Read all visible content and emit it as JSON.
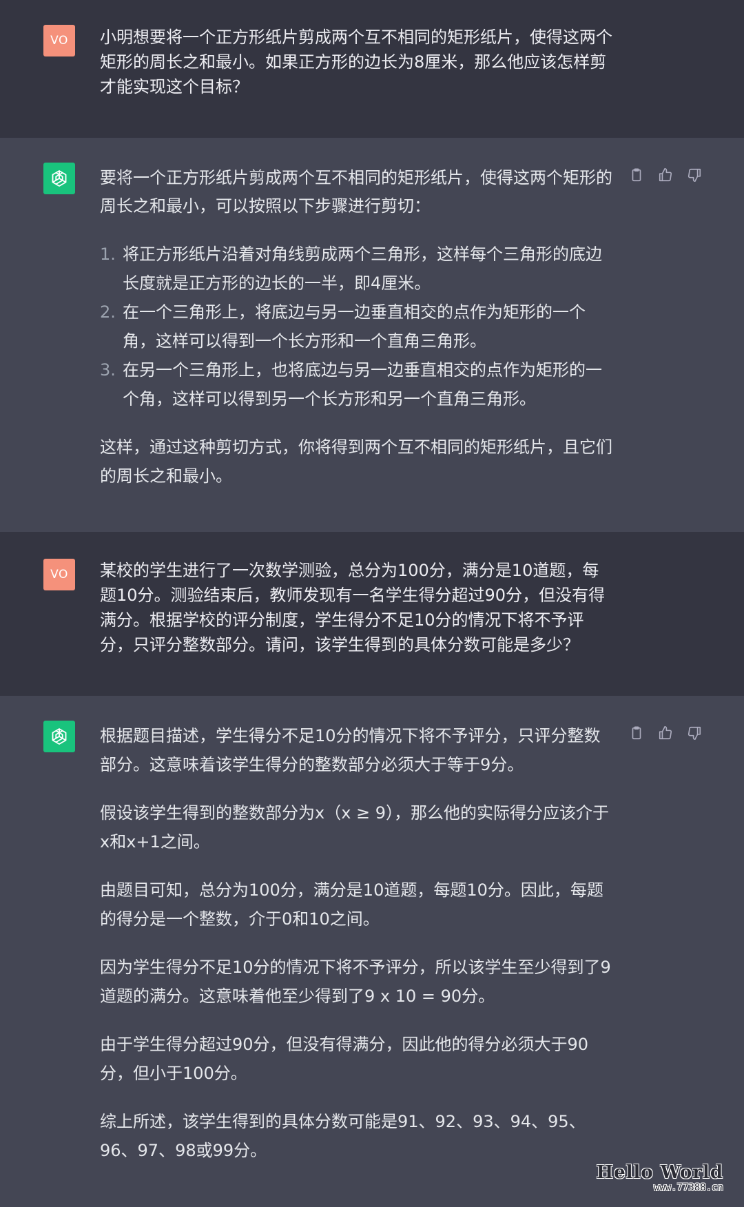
{
  "colors": {
    "user_bg": "#343541",
    "bot_bg": "#444654",
    "user_avatar": "#f5917b",
    "bot_avatar": "#19c37d"
  },
  "conversation": [
    {
      "role": "user",
      "avatar_text": "VO",
      "paragraphs": [
        "小明想要将一个正方形纸片剪成两个互不相同的矩形纸片，使得这两个矩形的周长之和最小。如果正方形的边长为8厘米，那么他应该怎样剪才能实现这个目标？"
      ]
    },
    {
      "role": "assistant",
      "avatar_icon": "openai-logo-icon",
      "intro": "要将一个正方形纸片剪成两个互不相同的矩形纸片，使得这两个矩形的周长之和最小，可以按照以下步骤进行剪切：",
      "list": [
        {
          "num": "1.",
          "text": "将正方形纸片沿着对角线剪成两个三角形，这样每个三角形的底边长度就是正方形的边长的一半，即4厘米。"
        },
        {
          "num": "2.",
          "text": "在一个三角形上，将底边与另一边垂直相交的点作为矩形的一个角，这样可以得到一个长方形和一个直角三角形。"
        },
        {
          "num": "3.",
          "text": "在另一个三角形上，也将底边与另一边垂直相交的点作为矩形的一个角，这样可以得到另一个长方形和另一个直角三角形。"
        }
      ],
      "outro": "这样，通过这种剪切方式，你将得到两个互不相同的矩形纸片，且它们的周长之和最小。",
      "actions": [
        "clipboard-icon",
        "thumbs-up-icon",
        "thumbs-down-icon"
      ]
    },
    {
      "role": "user",
      "avatar_text": "VO",
      "paragraphs": [
        "某校的学生进行了一次数学测验，总分为100分，满分是10道题，每题10分。测验结束后，教师发现有一名学生得分超过90分，但没有得满分。根据学校的评分制度，学生得分不足10分的情况下将不予评分，只评分整数部分。请问，该学生得到的具体分数可能是多少？"
      ]
    },
    {
      "role": "assistant",
      "avatar_icon": "openai-logo-icon",
      "paragraphs": [
        "根据题目描述，学生得分不足10分的情况下将不予评分，只评分整数部分。这意味着该学生得分的整数部分必须大于等于9分。",
        "假设该学生得到的整数部分为x（x ≥ 9），那么他的实际得分应该介于x和x+1之间。",
        "由题目可知，总分为100分，满分是10道题，每题10分。因此，每题的得分是一个整数，介于0和10之间。",
        "因为学生得分不足10分的情况下将不予评分，所以该学生至少得到了9道题的满分。这意味着他至少得到了9 x 10 = 90分。",
        "由于学生得分超过90分，但没有得满分，因此他的得分必须大于90分，但小于100分。",
        "综上所述，该学生得到的具体分数可能是91、92、93、94、95、96、97、98或99分。"
      ],
      "actions": [
        "clipboard-icon",
        "thumbs-up-icon",
        "thumbs-down-icon"
      ]
    }
  ],
  "watermark": {
    "title": "Hello World",
    "url": "www.77388.cn"
  }
}
